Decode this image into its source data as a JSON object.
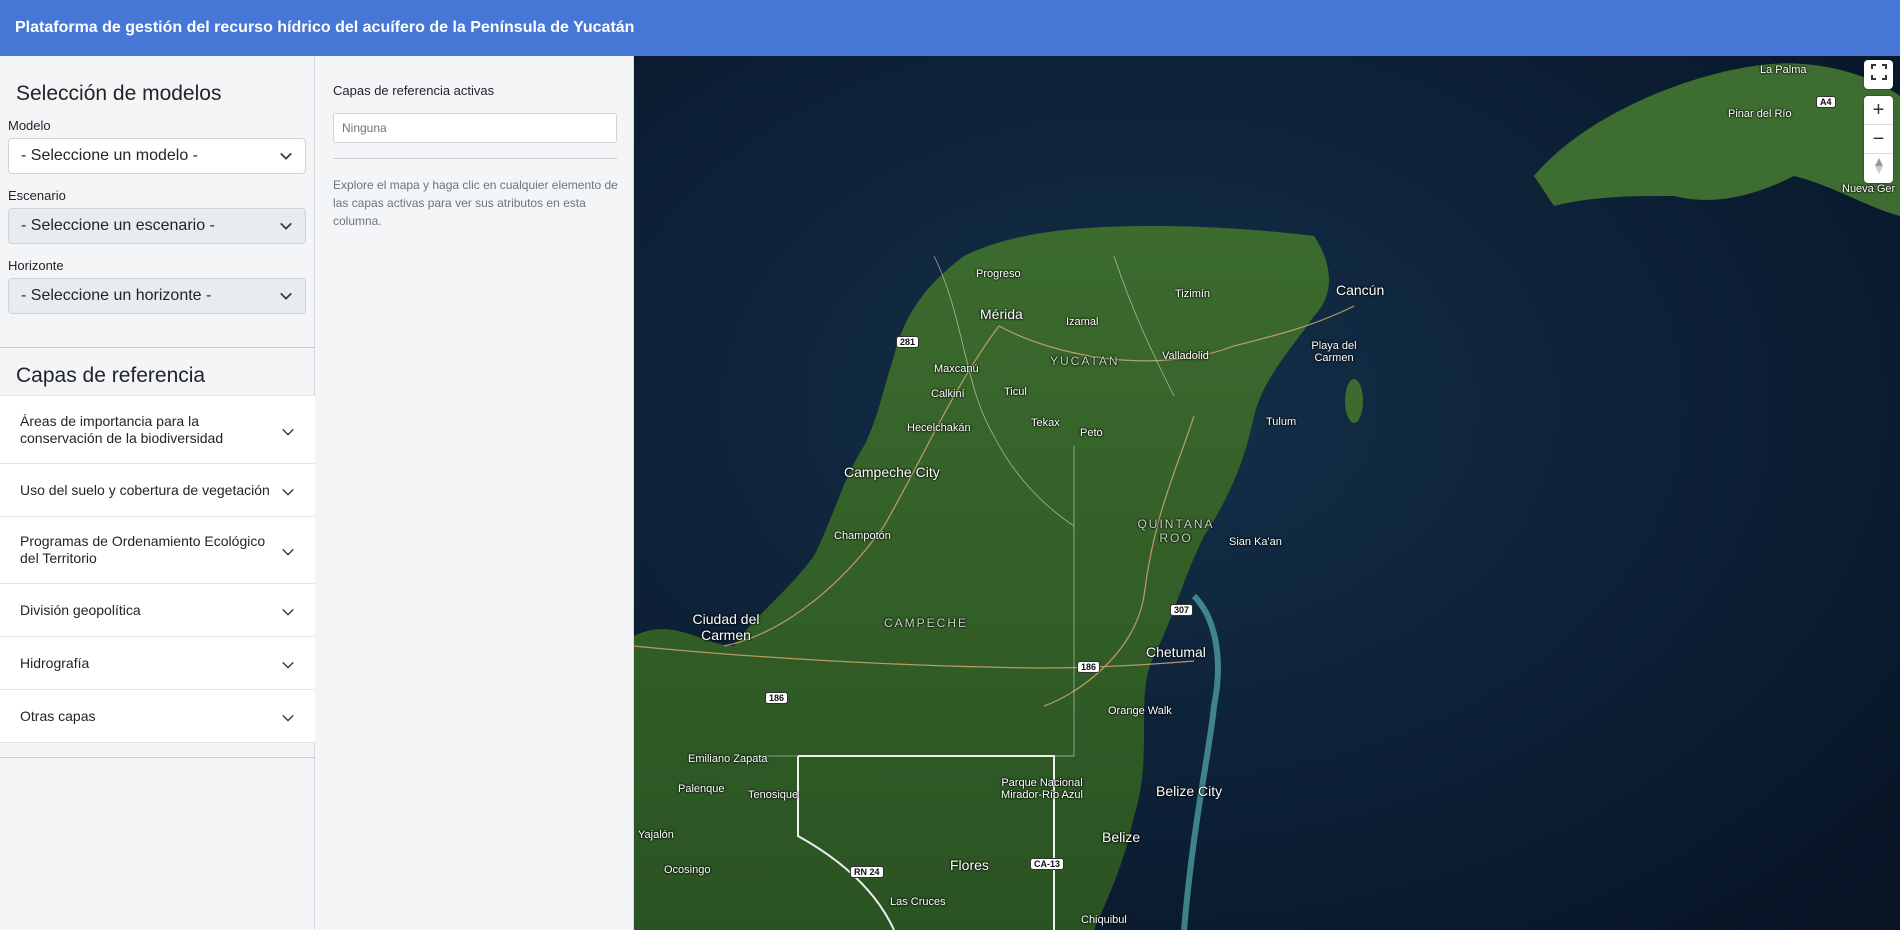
{
  "header": {
    "title": "Plataforma de gestión del recurso hídrico del acuífero de la Península de Yucatán"
  },
  "models": {
    "heading": "Selección de modelos",
    "model": {
      "label": "Modelo",
      "value": "- Seleccione un modelo -"
    },
    "scenario": {
      "label": "Escenario",
      "value": "- Seleccione un escenario -"
    },
    "horizon": {
      "label": "Horizonte",
      "value": "- Seleccione un horizonte -"
    }
  },
  "layers": {
    "heading": "Capas de referencia",
    "items": [
      {
        "label": "Áreas de importancia para la conservación de la biodiversidad"
      },
      {
        "label": "Uso del suelo y cobertura de vegetación"
      },
      {
        "label": "Programas de Ordenamiento Ecológico del Territorio"
      },
      {
        "label": "División geopolítica"
      },
      {
        "label": "Hidrografía"
      },
      {
        "label": "Otras capas"
      }
    ]
  },
  "info_panel": {
    "title": "Capas de referencia activas",
    "input_value": "Ninguna",
    "help": "Explore el mapa y haga clic en cualquier elemento de las capas activas para ver sus atributos en esta columna."
  },
  "map": {
    "places": [
      "Progreso",
      "Mérida",
      "Izamal",
      "Tizimín",
      "Cancún",
      "Valladolid",
      "Playa del Carmen",
      "Maxcanú",
      "Calkiní",
      "Ticul",
      "Tekax",
      "Peto",
      "Hecelchakán",
      "Tulum",
      "Campeche City",
      "Champotón",
      "Sian Ka'an",
      "Ciudad del Carmen",
      "Chetumal",
      "Orange Walk",
      "Emiliano Zapata",
      "Palenque",
      "Tenosique",
      "Parque Nacional Mirador-Río Azul",
      "Belize City",
      "Belize",
      "Flores",
      "Las Cruces",
      "Chiquibul",
      "Yajalón",
      "Ocosingo",
      "La Palma",
      "Pinar del Río",
      "Nueva Ger"
    ],
    "states": [
      "YUCATAN",
      "QUINTANA ROO",
      "CAMPECHE"
    ],
    "shields": [
      "281",
      "307",
      "186",
      "186",
      "RN 24",
      "CA-13",
      "A4"
    ],
    "controls": {
      "fullscreen": "fullscreen-icon",
      "zoom_in": "+",
      "zoom_out": "−",
      "compass": "compass-icon"
    }
  },
  "colors": {
    "header": "#4777d6",
    "land": "#2f5a27",
    "water": "#0b1a2c"
  }
}
